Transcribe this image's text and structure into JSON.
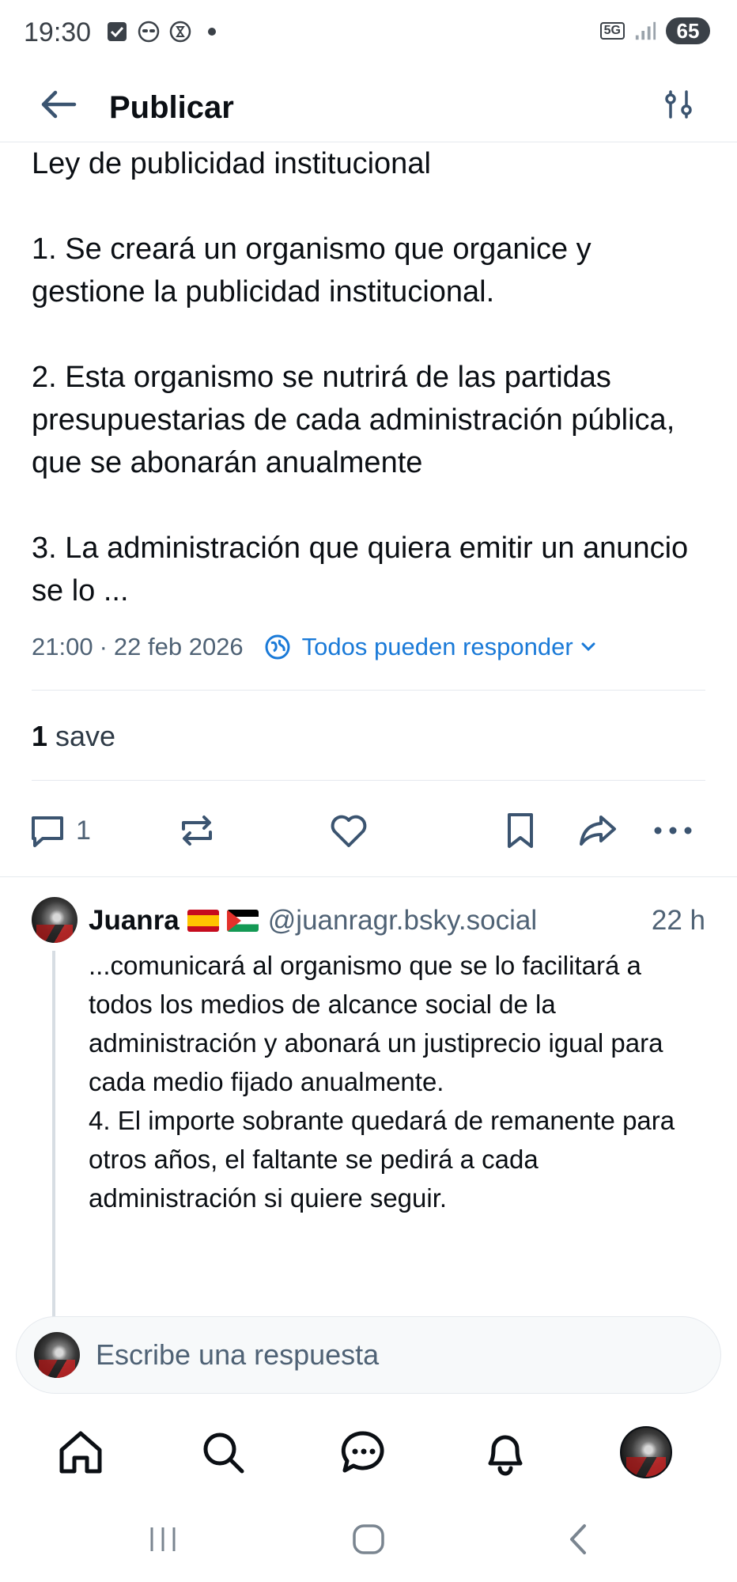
{
  "status_bar": {
    "time": "19:30",
    "network": "5G",
    "battery": "65",
    "icons": [
      "checkbox-icon",
      "incognito-icon",
      "hourglass-icon",
      "dot-icon",
      "signal-icon"
    ]
  },
  "header": {
    "title": "Publicar",
    "back_icon": "arrow-left-icon",
    "filter_icon": "sliders-icon"
  },
  "post": {
    "paragraphs": [
      "Ley de publicidad institucional",
      "",
      "1. Se creará un organismo que organice y gestione la publicidad institucional.",
      "",
      "2. Esta organismo se nutrirá de las partidas presupuestarias de cada administración pública, que se abonarán anualmente",
      "",
      "3. La administración que quiera emitir un anuncio se lo ..."
    ],
    "time": "21:00",
    "date": "22 feb 2026",
    "reply_setting": "Todos pueden responder",
    "saves_count": "1",
    "saves_label": "save",
    "reply_count": "1",
    "colors": {
      "accent": "#1a7ad8",
      "muted": "#4f6275"
    }
  },
  "reply": {
    "name": "Juanra",
    "flags": [
      "spain-flag",
      "palestine-flag"
    ],
    "handle": "@juanragr.bsky.social",
    "time": "22 h",
    "text": "...comunicará al organismo que se lo facilitará a todos los medios de alcance social de la administración y abonará un justiprecio igual para cada medio fijado anualmente.\n4. El importe sobrante quedará de remanente para otros años, el faltante se pedirá a cada administración si quiere seguir."
  },
  "composer": {
    "placeholder": "Escribe una respuesta"
  },
  "bottom_nav": [
    "home-icon",
    "search-icon",
    "chat-icon",
    "bell-icon",
    "profile-avatar"
  ]
}
